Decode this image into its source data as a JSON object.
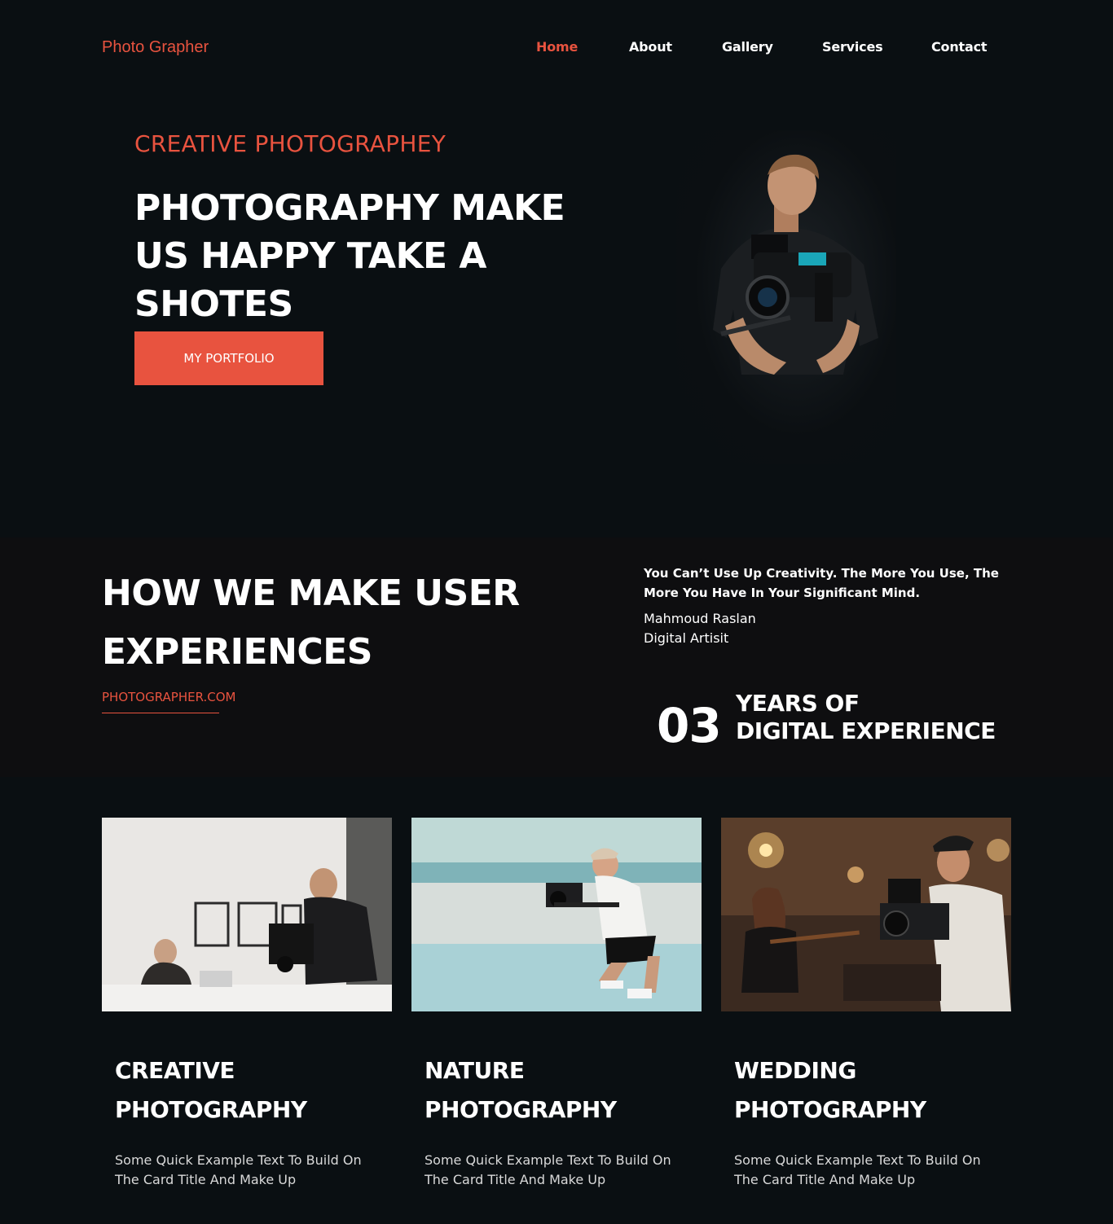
{
  "nav": {
    "logo": "Photo Grapher",
    "links": [
      "Home",
      "About",
      "Gallery",
      "Services",
      "Contact"
    ],
    "active": "Home"
  },
  "hero": {
    "eyebrow": "CREATIVE PHOTOGRAPHEY",
    "title": "PHOTOGRAPHY MAKE US HAPPY TAKE A SHOTES",
    "button": "MY PORTFOLIO"
  },
  "about": {
    "title": "HOW WE MAKE USER EXPERIENCES",
    "link": "PHOTOGRAPHER.COM",
    "quote": "You Can’t Use Up Creativity. The More You Use, The More You Have In Your Significant Mind.",
    "author_name": "Mahmoud Raslan",
    "author_role": "Digital Artisit",
    "years_number": "03",
    "years_line1": "YEARS OF",
    "years_line2": "DIGITAL EXPERIENCE"
  },
  "cards": [
    {
      "title_line1": "CREATIVE",
      "title_line2": "PHOTOGRAPHY",
      "text": "Some Quick Example Text To Build On The Card Title And Make Up"
    },
    {
      "title_line1": "NATURE",
      "title_line2": "PHOTOGRAPHY",
      "text": "Some Quick Example Text To Build On The Card Title And Make Up"
    },
    {
      "title_line1": "WEDDING",
      "title_line2": "PHOTOGRAPHY",
      "text": "Some Quick Example Text To Build On The Card Title And Make Up"
    }
  ],
  "colors": {
    "accent": "#e8533f",
    "background": "#0a0f12",
    "strip": "#0e0e10",
    "text": "#ffffff"
  }
}
